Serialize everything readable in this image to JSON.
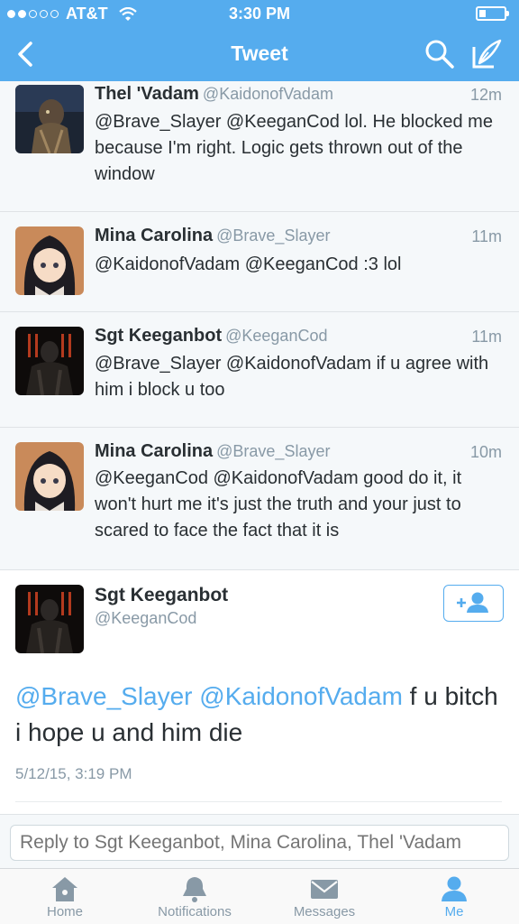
{
  "status": {
    "carrier": "AT&T",
    "time": "3:30 PM",
    "signal_bars": 2,
    "battery_level": 0.25
  },
  "nav": {
    "title": "Tweet"
  },
  "tweets": [
    {
      "name": "Thel 'Vadam",
      "handle": "@KaidonofVadam",
      "time": "12m",
      "text": "@Brave_Slayer @KeeganCod lol. He blocked me because I'm right. Logic gets thrown out of the window",
      "avatar": "armored-character"
    },
    {
      "name": "Mina Carolina",
      "handle": "@Brave_Slayer",
      "time": "11m",
      "text": "@KaidonofVadam @KeeganCod :3 lol",
      "avatar": "anime-girl"
    },
    {
      "name": "Sgt Keeganbot",
      "handle": "@KeeganCod",
      "time": "11m",
      "text": "@Brave_Slayer @KaidonofVadam if u agree with him i block u too",
      "avatar": "dark-soldier"
    },
    {
      "name": "Mina Carolina",
      "handle": "@Brave_Slayer",
      "time": "10m",
      "text": "@KeeganCod @KaidonofVadam good do it, it won't hurt me it's just the truth and your just to scared to face the fact that it is",
      "avatar": "anime-girl"
    }
  ],
  "main_tweet": {
    "name": "Sgt Keeganbot",
    "handle": "@KeeganCod",
    "mention1": "@Brave_Slayer",
    "mention2": "@KaidonofVadam",
    "text": " f u bitch i hope u and him die",
    "date": "5/12/15, 3:19 PM"
  },
  "reply": {
    "placeholder": "Reply to Sgt Keeganbot, Mina Carolina, Thel 'Vadam"
  },
  "tabs": [
    {
      "label": "Home",
      "icon": "home-icon",
      "active": false
    },
    {
      "label": "Notifications",
      "icon": "bell-icon",
      "active": false
    },
    {
      "label": "Messages",
      "icon": "envelope-icon",
      "active": false
    },
    {
      "label": "Me",
      "icon": "person-icon",
      "active": true
    }
  ],
  "colors": {
    "brand": "#55acee",
    "text": "#292f33",
    "muted": "#8899a6",
    "background": "#f5f8fa"
  }
}
